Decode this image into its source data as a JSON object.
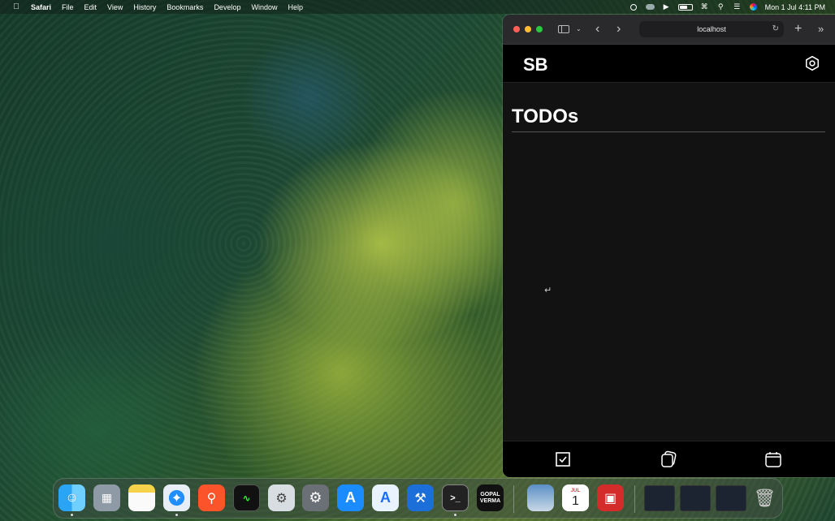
{
  "menubar": {
    "app_name": "Safari",
    "menus": [
      "File",
      "Edit",
      "View",
      "History",
      "Bookmarks",
      "Develop",
      "Window",
      "Help"
    ],
    "clock": "Mon 1 Jul  4:11 PM"
  },
  "browser": {
    "url": "localhost"
  },
  "app": {
    "brand": "SB",
    "heading": "TODOs"
  },
  "dock": {
    "apps": [
      "finder",
      "launchpad",
      "notes",
      "brave",
      "activity-monitor",
      "disk-utility",
      "system-settings",
      "app-store",
      "instruments",
      "xcode",
      "terminal",
      "gopal-verma",
      "preview",
      "calendar",
      "photo-booth"
    ],
    "gopal_label": "GOPAL\nVERMA",
    "calendar_month": "JUL",
    "calendar_day": "1"
  },
  "colors": {
    "accent_red": "#ff5f57",
    "accent_yellow": "#febc2e",
    "accent_green": "#28c840",
    "page_bg": "#121212"
  }
}
